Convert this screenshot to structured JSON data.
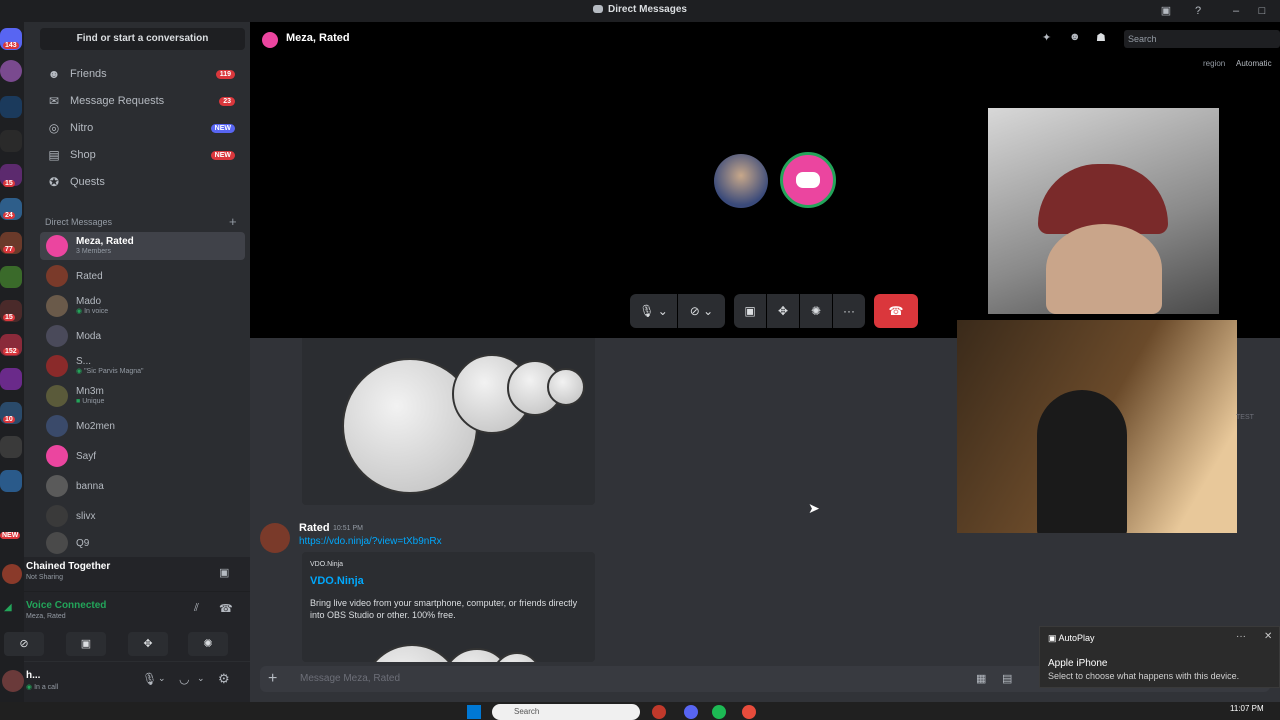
{
  "window": {
    "title": "Direct Messages"
  },
  "sidebar": {
    "search_label": "Find or start a conversation",
    "nav": [
      {
        "label": "Friends",
        "badge": "119"
      },
      {
        "label": "Message Requests",
        "badge": "23"
      },
      {
        "label": "Nitro",
        "badge": "NEW"
      },
      {
        "label": "Shop",
        "badge": "NEW"
      },
      {
        "label": "Quests"
      }
    ],
    "dm_header": "Direct Messages",
    "dms": [
      {
        "name": "Meza, Rated",
        "sub": "3 Members"
      },
      {
        "name": "Rated",
        "sub": ""
      },
      {
        "name": "Mado",
        "sub": "In voice"
      },
      {
        "name": "Moda",
        "sub": ""
      },
      {
        "name": "S...",
        "sub": "\"Sic Parvis Magna\""
      },
      {
        "name": "Mn3m",
        "sub": "Unique"
      },
      {
        "name": "Mo2men",
        "sub": ""
      },
      {
        "name": "Sayf",
        "sub": ""
      },
      {
        "name": "banna",
        "sub": ""
      },
      {
        "name": "slivx",
        "sub": ""
      },
      {
        "name": "Q9",
        "sub": ""
      }
    ],
    "activity": {
      "title": "Chained Together",
      "sub": "Not Sharing"
    },
    "voice": {
      "status": "Voice Connected",
      "channel": "Meza, Rated"
    },
    "user": {
      "name": "h...",
      "status": "In a call"
    },
    "server_badges": [
      "143",
      "15",
      "24",
      "77",
      "15",
      "152",
      "10",
      "NEW"
    ]
  },
  "call": {
    "title": "Meza, Rated",
    "search_placeholder": "Search",
    "region_label": "region",
    "region_value": "Automatic"
  },
  "chat": {
    "message": {
      "author": "Rated",
      "time": "10:51 PM",
      "link": "https://vdo.ninja/?view=tXb9nRx",
      "embed": {
        "provider": "VDO.Ninja",
        "title": "VDO.Ninja",
        "description": "Bring live video from your smartphone, computer, or friends directly into OBS Studio or other. 100% free."
      }
    },
    "composer_placeholder": "Message Meza, Rated",
    "test_label": "TEST"
  },
  "toast": {
    "app": "AutoPlay",
    "title": "Apple iPhone",
    "body": "Select to choose what happens with this device."
  },
  "taskbar": {
    "time": "11:07 PM",
    "search": "Search"
  },
  "colors": {
    "accent": "#eb459f",
    "danger": "#da373c",
    "online": "#23a55a",
    "link": "#00a8fc"
  }
}
